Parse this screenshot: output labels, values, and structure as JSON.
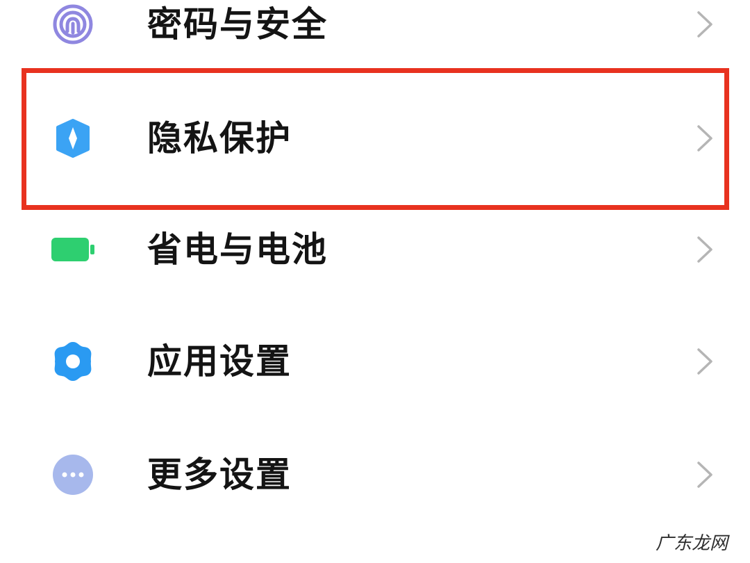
{
  "settings": {
    "items": [
      {
        "label": "密码与安全",
        "icon": "fingerprint-icon",
        "icon_color": "#8f87e0"
      },
      {
        "label": "隐私保护",
        "icon": "privacy-shield-icon",
        "icon_color": "#3ba3f4"
      },
      {
        "label": "省电与电池",
        "icon": "battery-icon",
        "icon_color": "#2ecf70"
      },
      {
        "label": "应用设置",
        "icon": "gear-icon",
        "icon_color": "#2a9af2"
      },
      {
        "label": "更多设置",
        "icon": "more-dots-icon",
        "icon_color": "#a7b8ec"
      }
    ],
    "highlighted_item": "隐私保护",
    "highlight_color": "#e8321f"
  },
  "watermark": {
    "text": "广东龙网"
  }
}
